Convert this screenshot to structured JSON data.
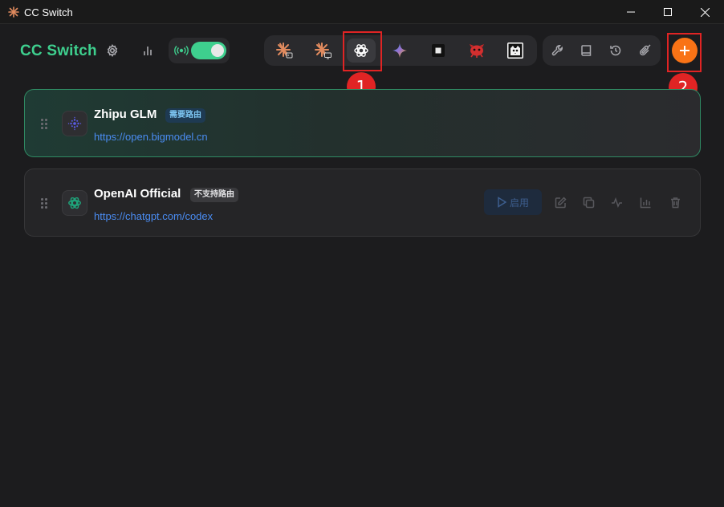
{
  "window": {
    "title": "CC Switch",
    "controls": [
      "minimize",
      "maximize",
      "close"
    ]
  },
  "header": {
    "brand": "CC Switch",
    "brand_color": "#3ecf8e",
    "settings_icon": "gear-icon",
    "stats_icon": "bar-chart-icon",
    "proxy_toggle": {
      "icon": "radio-wave-icon",
      "on": true
    }
  },
  "app_tabs": [
    {
      "name": "claude-terminal",
      "icon": "claude-terminal-icon",
      "active": false
    },
    {
      "name": "claude-desktop",
      "icon": "claude-desktop-icon",
      "active": false
    },
    {
      "name": "codex",
      "icon": "openai-icon",
      "active": true
    },
    {
      "name": "gemini",
      "icon": "gemini-icon",
      "active": false
    },
    {
      "name": "terminal-app",
      "icon": "black-square-icon",
      "active": false
    },
    {
      "name": "red-mascot",
      "icon": "red-mascot-icon",
      "active": false
    },
    {
      "name": "cat-app",
      "icon": "cat-avatar-icon",
      "active": false
    }
  ],
  "tools": [
    {
      "name": "tools",
      "icon": "wrench-icon"
    },
    {
      "name": "prompts",
      "icon": "book-icon"
    },
    {
      "name": "history",
      "icon": "history-icon"
    },
    {
      "name": "skills",
      "icon": "paperclip-icon"
    }
  ],
  "add_button": {
    "icon": "plus-icon",
    "color": "#f97316"
  },
  "annotations": [
    {
      "label": "1",
      "target": "codex-tab"
    },
    {
      "label": "2",
      "target": "add-button"
    }
  ],
  "providers": [
    {
      "name": "Zhipu GLM",
      "badge": "需要路由",
      "url": "https://open.bigmodel.cn",
      "icon": "zhipu-icon",
      "active": true
    },
    {
      "name": "OpenAI Official",
      "badge": "不支持路由",
      "url": "https://chatgpt.com/codex",
      "icon": "openai-icon",
      "active": false,
      "enable_label": "启用",
      "actions": [
        "edit-icon",
        "copy-icon",
        "pulse-icon",
        "stats-icon",
        "trash-icon"
      ]
    }
  ]
}
